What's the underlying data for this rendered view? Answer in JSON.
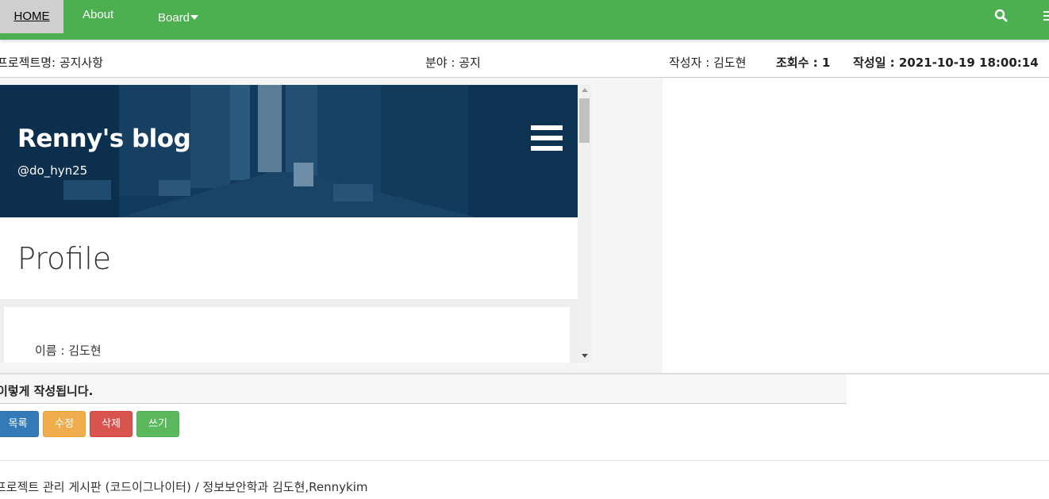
{
  "nav": {
    "home": "HOME",
    "about": "About",
    "board": "Board"
  },
  "meta": {
    "project": "프로젝트명: 공지사항",
    "field": "분야 : 공지",
    "author": "작성자 : 김도현",
    "views": "조회수 : 1",
    "date": "작성일 : 2021-10-19 18:00:14"
  },
  "embed": {
    "blog_title": "Renny's blog",
    "blog_handle": "@do_hyn25",
    "section_title": "Profile",
    "name_label": "이름 : 김도현"
  },
  "post": {
    "body": "이렇게 작성됩니다."
  },
  "buttons": {
    "list": "목록",
    "edit": "수정",
    "delete": "삭제",
    "write": "쓰기"
  },
  "footer": {
    "text": "프로젝트 관리 게시판 (코드이그나이터) / 정보보안학과 김도현,Rennykim"
  },
  "colors": {
    "nav_bg": "#4caf50",
    "hero_bg": "#0f3a5e",
    "btn_primary": "#337ab7",
    "btn_warning": "#f0ad4e",
    "btn_danger": "#d9534f",
    "btn_success": "#5cb85c"
  },
  "icons": {
    "search": "search-icon",
    "menu": "menu-icon",
    "caret": "caret-down-icon"
  }
}
